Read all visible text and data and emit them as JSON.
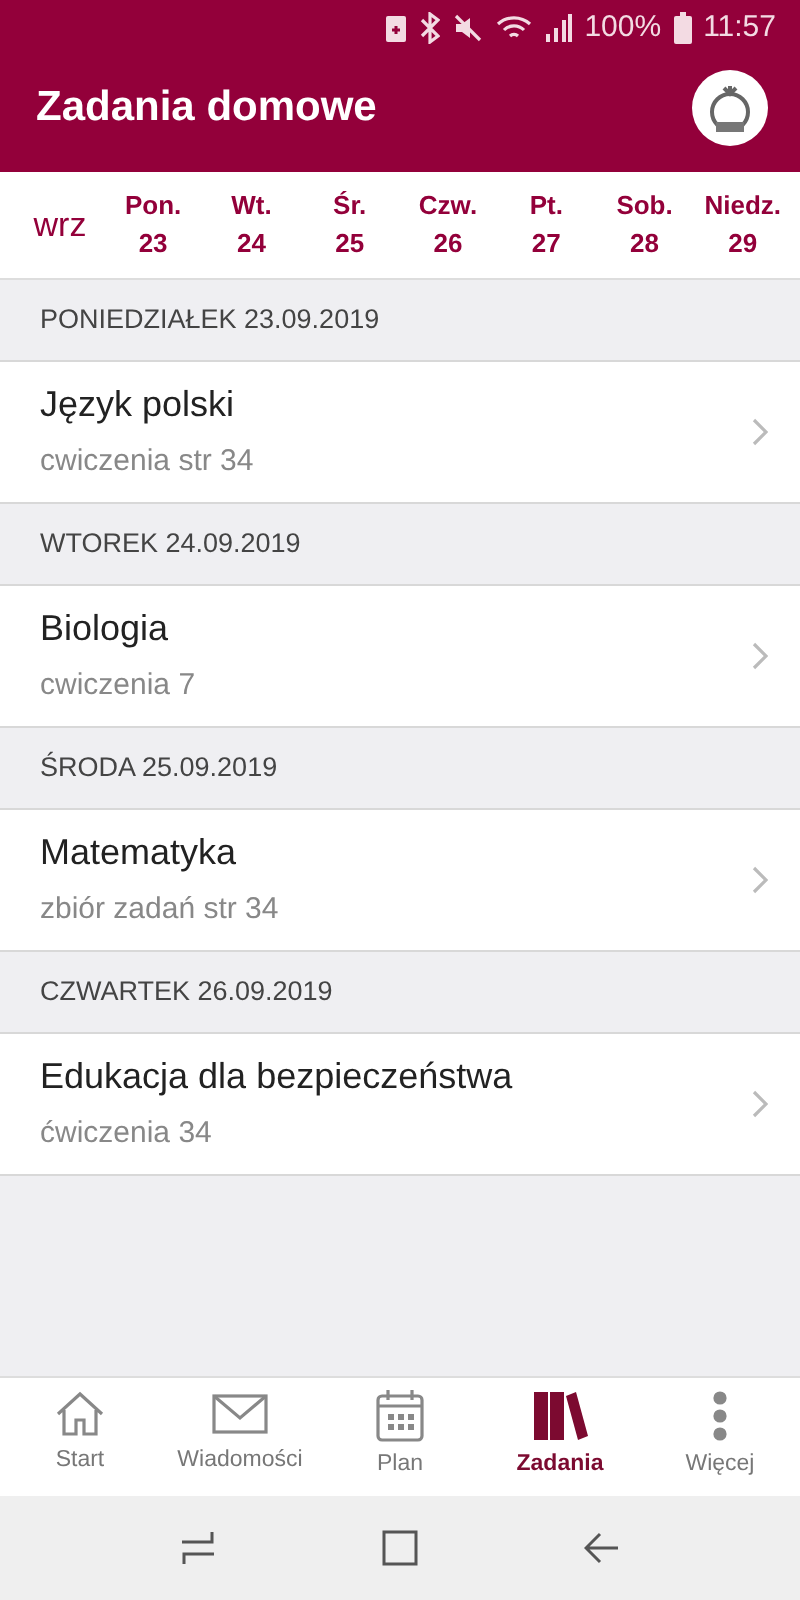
{
  "status_bar": {
    "battery": "100%",
    "time": "11:57"
  },
  "header": {
    "title": "Zadania domowe"
  },
  "week": {
    "month": "wrz",
    "days": [
      {
        "name": "Pon.",
        "date": "23"
      },
      {
        "name": "Wt.",
        "date": "24"
      },
      {
        "name": "Śr.",
        "date": "25"
      },
      {
        "name": "Czw.",
        "date": "26"
      },
      {
        "name": "Pt.",
        "date": "27"
      },
      {
        "name": "Sob.",
        "date": "28"
      },
      {
        "name": "Niedz.",
        "date": "29"
      }
    ]
  },
  "sections": [
    {
      "heading": "PONIEDZIAŁEK 23.09.2019",
      "items": [
        {
          "subject": "Język polski",
          "detail": "cwiczenia str 34"
        }
      ]
    },
    {
      "heading": "WTOREK 24.09.2019",
      "items": [
        {
          "subject": "Biologia",
          "detail": "cwiczenia 7"
        }
      ]
    },
    {
      "heading": "ŚRODA 25.09.2019",
      "items": [
        {
          "subject": "Matematyka",
          "detail": "zbiór zadań str 34"
        }
      ]
    },
    {
      "heading": "CZWARTEK 26.09.2019",
      "items": [
        {
          "subject": "Edukacja dla bezpieczeństwa",
          "detail": "ćwiczenia 34"
        }
      ]
    }
  ],
  "tab_bar": [
    {
      "kind": "home",
      "label": "Start",
      "selected": false
    },
    {
      "kind": "mail",
      "label": "Wiadomości",
      "selected": false
    },
    {
      "kind": "calendar",
      "label": "Plan",
      "selected": false
    },
    {
      "kind": "books",
      "label": "Zadania",
      "selected": true
    },
    {
      "kind": "more",
      "label": "Więcej",
      "selected": false
    }
  ]
}
